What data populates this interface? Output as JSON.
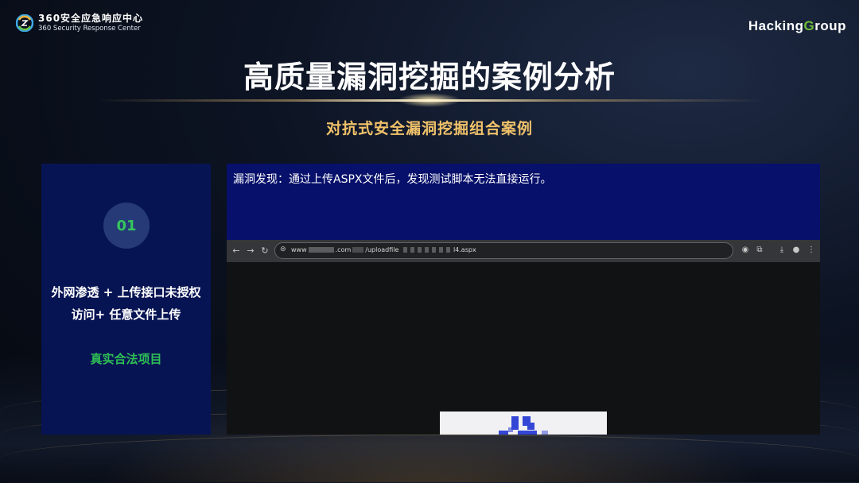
{
  "brand": {
    "cn": "360安全应急响应中心",
    "en": "360 Security Response Center",
    "partner_prefix": "Hacking",
    "partner_g": "G",
    "partner_suffix": "roup"
  },
  "slide": {
    "title": "高质量漏洞挖掘的案例分析",
    "subtitle": "对抗式安全漏洞挖掘组合案例"
  },
  "case": {
    "number": "01",
    "desc_line1": "外网渗透 + 上传接口未授权",
    "desc_line2": "访问+ 任意文件上传",
    "tag": "真实合法项目"
  },
  "finding": {
    "text": "漏洞发现：通过上传ASPX文件后，发现测试脚本无法直接运行。"
  },
  "browser": {
    "url_prefix": "www",
    "url_domain_end": ".com",
    "url_path": "/uploadfile",
    "url_file": "l4.aspx",
    "icons": {
      "back": "arrow-left-icon",
      "forward": "arrow-right-icon",
      "reload": "reload-icon",
      "site_info": "site-info-icon",
      "extension": "extension-icon",
      "puzzle": "puzzle-icon",
      "download": "download-icon",
      "profile": "profile-icon",
      "menu": "kebab-menu-icon"
    }
  },
  "colors": {
    "title": "#ffffff",
    "subtitle": "#f1c26a",
    "left_card_bg": "#071453",
    "number_color": "#35c45d",
    "tag_color": "#2fbf55",
    "right_card_bg": "#07106a",
    "partner_g": "#6fbf3b"
  }
}
